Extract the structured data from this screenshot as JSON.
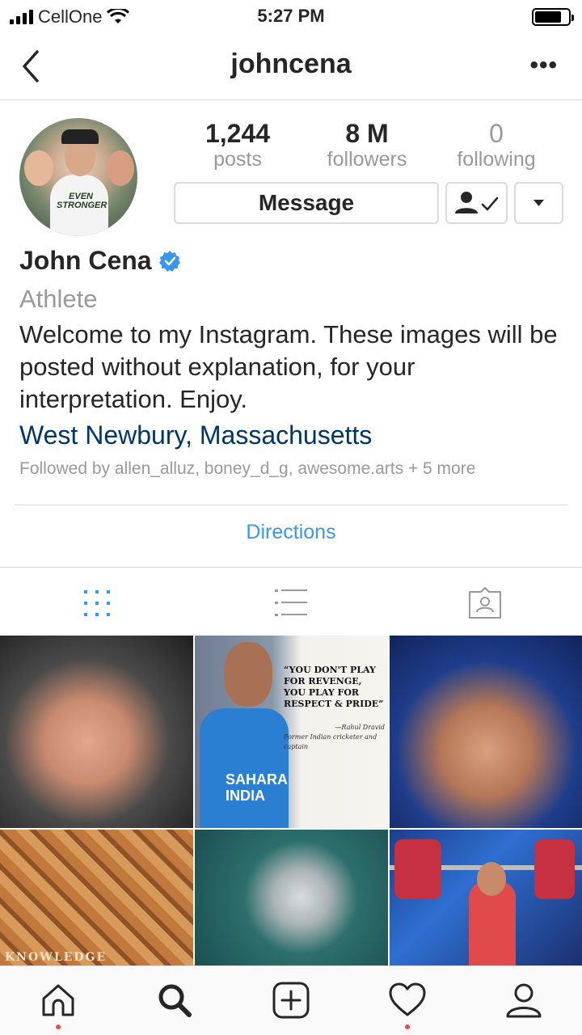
{
  "status_bar": {
    "carrier": "CellOne",
    "time": "5:27 PM"
  },
  "nav": {
    "title": "johncena",
    "more_label": "•••"
  },
  "profile": {
    "stats": [
      {
        "value": "1,244",
        "label": "posts"
      },
      {
        "value": "8 M",
        "label": "followers"
      },
      {
        "value": "0",
        "label": "following"
      }
    ],
    "message_label": "Message",
    "name": "John Cena",
    "category": "Athlete",
    "bio": "Welcome to my Instagram. These images will be posted without explanation, for your interpretation. Enjoy.",
    "location": "West Newbury, Massachusetts",
    "followed_by": "Followed by allen_alluz, boney_d_g, awesome.arts + 5 more",
    "avatar_shirt_text": "EVEN STRONGER",
    "directions_label": "Directions"
  },
  "grid": {
    "quote_text": "“YOU DON'T PLAY FOR REVENGE, YOU PLAY FOR RESPECT & PRIDE”",
    "quote_author": "—Rahul Dravid",
    "quote_author_desc": "Former Indian cricketer and captain",
    "jersey_text": "SAHARA INDIA",
    "mosaic_text": "KNOWLEDGE"
  },
  "colors": {
    "link": "#3897f0",
    "location": "#003569",
    "verified": "#3897f0",
    "notification_dot": "#ed4956"
  },
  "icons": {
    "tabs": [
      "grid-icon",
      "list-icon",
      "tagged-icon"
    ],
    "bottom": [
      "home-icon",
      "search-icon",
      "add-post-icon",
      "activity-heart-icon",
      "profile-icon"
    ]
  }
}
